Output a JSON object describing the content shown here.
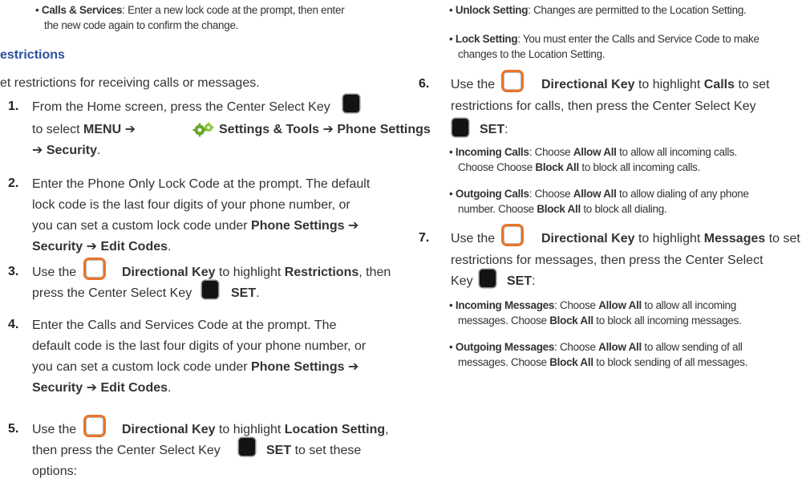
{
  "arrow": "➔",
  "key_label_set": "SET",
  "left": {
    "top_bullet": {
      "label": "Calls & Services",
      "text1": ": Enter a new lock code at the prompt, then enter",
      "text2": "the new code again to confirm the change."
    },
    "heading": "estrictions",
    "intro": "et restrictions for receiving calls or messages.",
    "steps": [
      {
        "number": "1.",
        "l1": "From the Home screen, press the Center Select Key",
        "l2_pre": "to select",
        "menu": "MENU",
        "settings_tools": "Settings & Tools",
        "phone_settings": "Phone Settings",
        "security": "Security",
        "end": "."
      },
      {
        "number": "2.",
        "l1": "Enter the Phone Only Lock Code at the prompt. The default",
        "l2": "lock code is the last four digits of your phone number, or",
        "l3_pre": "you can set a custom lock code under",
        "phone_settings": "Phone Settings",
        "security": "Security",
        "edit_codes": "Edit Codes",
        "end": "."
      },
      {
        "number": "3.",
        "use_the": "Use the",
        "directional_key": "Directional Key",
        "to_highlight": "to highlight",
        "target": "Restrictions",
        "after_target": ", then",
        "l2": "press the Center Select Key",
        "end": "."
      },
      {
        "number": "4.",
        "l1": "Enter the Calls and Services Code at the prompt. The",
        "l2": "default code is the last four digits of your phone number, or",
        "l3_pre": "you can set a custom lock code under",
        "phone_settings": "Phone Settings",
        "security": "Security",
        "edit_codes": "Edit Codes",
        "end": "."
      },
      {
        "number": "5.",
        "use_the": "Use the",
        "directional_key": "Directional Key",
        "to_highlight": "to highlight",
        "target": "Location Setting",
        "after_target": ",",
        "l2_pre": "then press the Center Select Key",
        "l2_post": "to set these",
        "l3": "options:"
      }
    ]
  },
  "right": {
    "loc_bullets": [
      {
        "label": "Unlock Setting",
        "text1": ": Changes are permitted to the Location Setting."
      },
      {
        "label": "Lock Setting",
        "text1": ": You must enter the Calls and Service Code to make",
        "text2": "changes to the Location Setting."
      }
    ],
    "step6": {
      "number": "6.",
      "use_the": "Use the",
      "directional_key": "Directional Key",
      "to_highlight": "to highlight",
      "target": "Calls",
      "after_target": "to set",
      "l2": "restrictions for calls, then press the Center Select Key",
      "end": ":"
    },
    "calls_bullets": [
      {
        "label": "Incoming Calls",
        "t1": ": Choose",
        "allow": "Allow All",
        "t2": "to allow all incoming calls.",
        "l2_pre": "Choose Choose",
        "block": "Block All",
        "l2_post": "to block all incoming calls."
      },
      {
        "label": "Outgoing Calls",
        "t1": ": Choose",
        "allow": "Allow All",
        "t2": "to allow dialing of any phone",
        "l2_pre": "number. Choose",
        "block": "Block All",
        "l2_post": "to block all dialing."
      }
    ],
    "step7": {
      "number": "7.",
      "use_the": "Use the",
      "directional_key": "Directional Key",
      "to_highlight": "to highlight",
      "target": "Messages",
      "after_target": "to set",
      "l2": "restrictions for messages, then press the Center Select",
      "l3": "Key",
      "end": ":"
    },
    "msg_bullets": [
      {
        "label": "Incoming Messages",
        "t1": ": Choose",
        "allow": "Allow All",
        "t2": "to allow all incoming",
        "l2_pre": "messages. Choose",
        "block": "Block All",
        "l2_post": "to block all incoming messages."
      },
      {
        "label": "Outgoing Messages",
        "t1": ": Choose",
        "allow": "Allow All",
        "t2": "to allow sending of all",
        "l2_pre": "messages. Choose",
        "block": "Block All",
        "l2_post": "to block sending of all messages."
      }
    ]
  }
}
